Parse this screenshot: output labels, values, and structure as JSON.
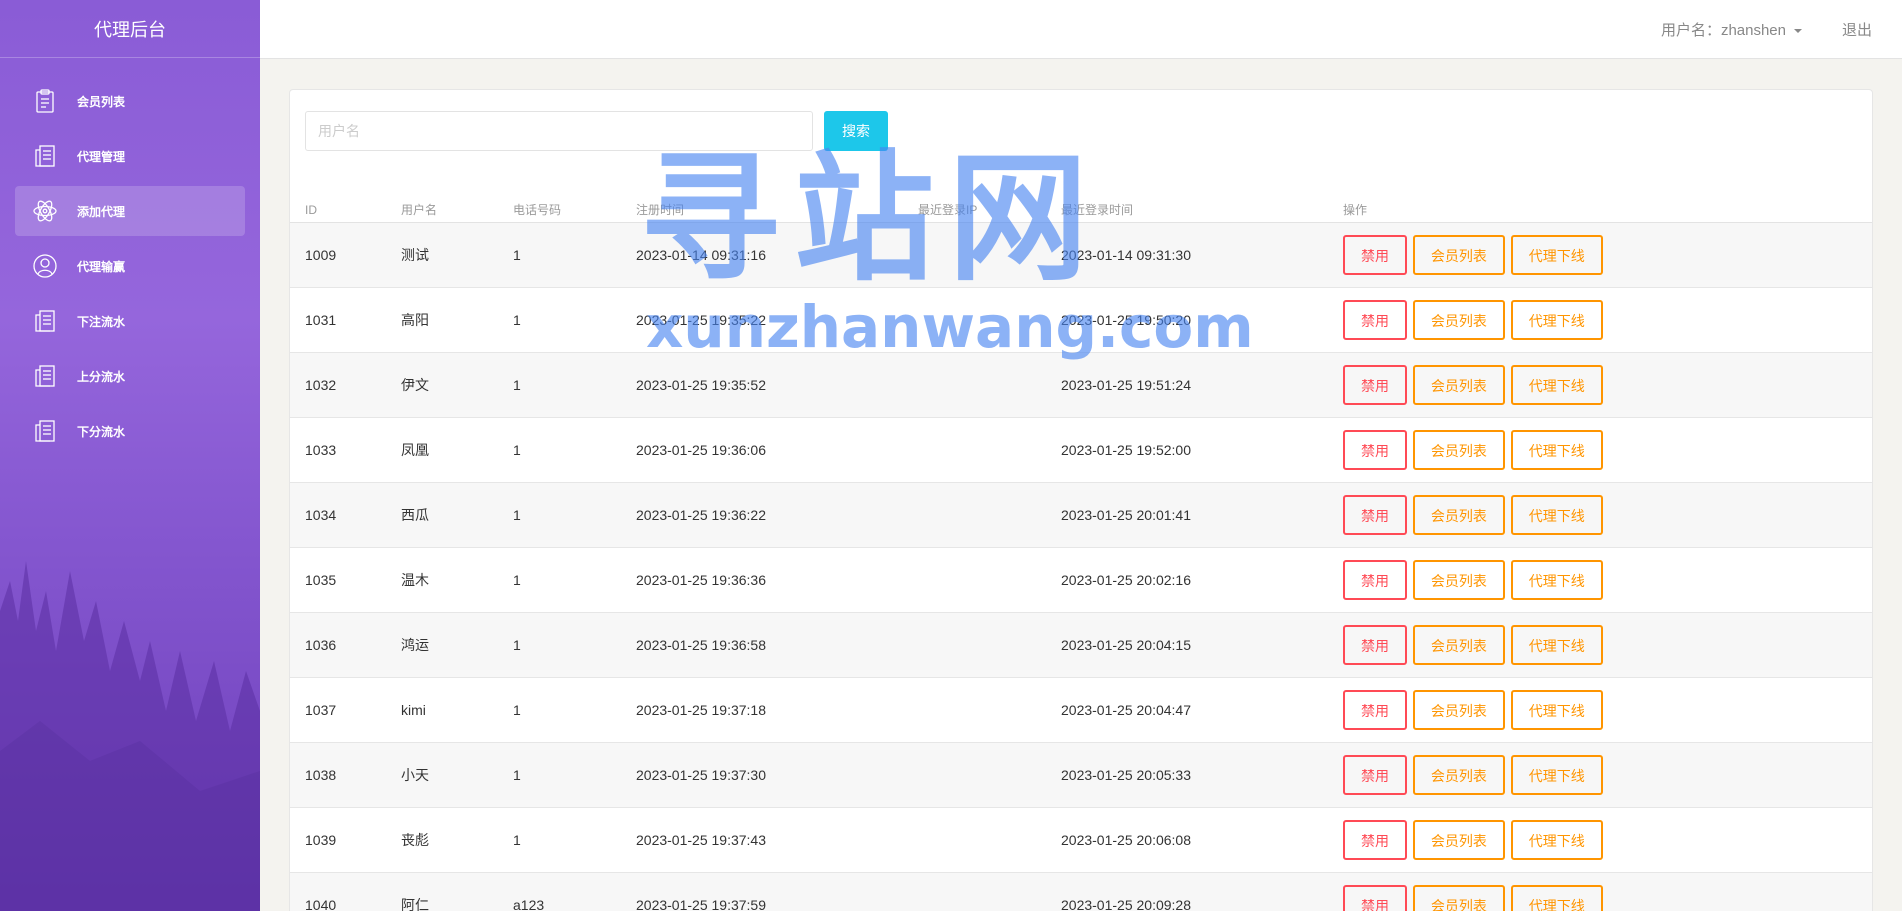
{
  "app": {
    "title": "代理后台"
  },
  "sidebar": {
    "items": [
      {
        "label": "会员列表",
        "icon": "clipboard-icon",
        "active": false
      },
      {
        "label": "代理管理",
        "icon": "document-list-icon",
        "active": false
      },
      {
        "label": "添加代理",
        "icon": "atom-icon",
        "active": true
      },
      {
        "label": "代理输赢",
        "icon": "user-circle-icon",
        "active": false
      },
      {
        "label": "下注流水",
        "icon": "document-list-icon",
        "active": false
      },
      {
        "label": "上分流水",
        "icon": "document-list-icon",
        "active": false
      },
      {
        "label": "下分流水",
        "icon": "document-list-icon",
        "active": false
      }
    ]
  },
  "header": {
    "user_label": "用户名：zhanshen",
    "logout": "退出"
  },
  "search": {
    "placeholder": "用户名",
    "button": "搜索"
  },
  "table": {
    "columns": [
      "ID",
      "用户名",
      "电话号码",
      "注册时间",
      "最近登录IP",
      "最近登录时间",
      "操作"
    ],
    "actions": {
      "disable": "禁用",
      "members": "会员列表",
      "offline": "代理下线"
    },
    "rows": [
      {
        "id": "1009",
        "name": "测试",
        "phone": "1",
        "reg": "2023-01-14 09:31:16",
        "ip": "",
        "last": "2023-01-14 09:31:30"
      },
      {
        "id": "1031",
        "name": "高阳",
        "phone": "1",
        "reg": "2023-01-25 19:35:22",
        "ip": "",
        "last": "2023-01-25 19:50:20"
      },
      {
        "id": "1032",
        "name": "伊文",
        "phone": "1",
        "reg": "2023-01-25 19:35:52",
        "ip": "",
        "last": "2023-01-25 19:51:24"
      },
      {
        "id": "1033",
        "name": "凤凰",
        "phone": "1",
        "reg": "2023-01-25 19:36:06",
        "ip": "",
        "last": "2023-01-25 19:52:00"
      },
      {
        "id": "1034",
        "name": "西瓜",
        "phone": "1",
        "reg": "2023-01-25 19:36:22",
        "ip": "",
        "last": "2023-01-25 20:01:41"
      },
      {
        "id": "1035",
        "name": "温木",
        "phone": "1",
        "reg": "2023-01-25 19:36:36",
        "ip": "",
        "last": "2023-01-25 20:02:16"
      },
      {
        "id": "1036",
        "name": "鸿运",
        "phone": "1",
        "reg": "2023-01-25 19:36:58",
        "ip": "",
        "last": "2023-01-25 20:04:15"
      },
      {
        "id": "1037",
        "name": "kimi",
        "phone": "1",
        "reg": "2023-01-25 19:37:18",
        "ip": "",
        "last": "2023-01-25 20:04:47"
      },
      {
        "id": "1038",
        "name": "小天",
        "phone": "1",
        "reg": "2023-01-25 19:37:30",
        "ip": "",
        "last": "2023-01-25 20:05:33"
      },
      {
        "id": "1039",
        "name": "丧彪",
        "phone": "1",
        "reg": "2023-01-25 19:37:43",
        "ip": "",
        "last": "2023-01-25 20:06:08"
      },
      {
        "id": "1040",
        "name": "阿仁",
        "phone": "a123",
        "reg": "2023-01-25 19:37:59",
        "ip": "",
        "last": "2023-01-25 20:09:28"
      }
    ]
  },
  "watermark": {
    "title": "寻站网",
    "url": "xunzhanwang.com"
  },
  "colors": {
    "accent": "#1dc7ea",
    "danger": "#ff4a55",
    "warning": "#ff9500",
    "sidebar": "#8a5cd6"
  }
}
